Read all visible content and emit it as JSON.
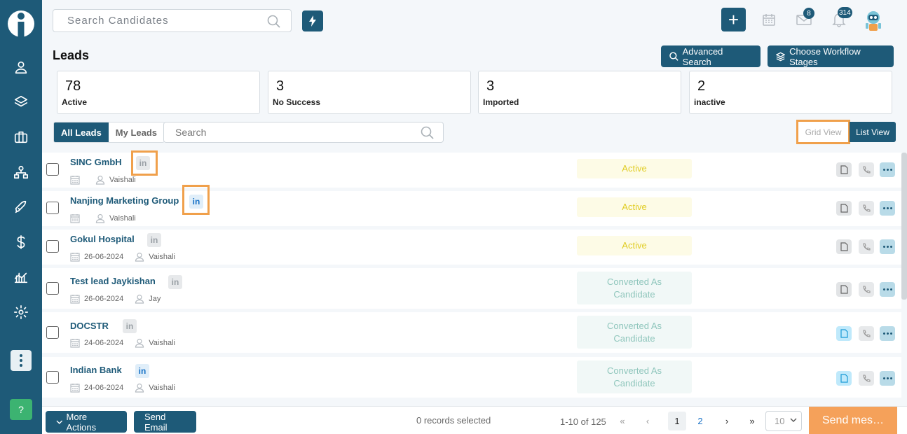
{
  "top": {
    "search_placeholder": "Search Candidates",
    "mail_badge": "8",
    "bell_badge": "314"
  },
  "header": {
    "title": "Leads",
    "advanced_search": "Advanced Search",
    "workflow_stages": "Choose Workflow Stages"
  },
  "stats": [
    {
      "value": "78",
      "label": "Active"
    },
    {
      "value": "3",
      "label": "No Success"
    },
    {
      "value": "3",
      "label": "Imported"
    },
    {
      "value": "2",
      "label": "inactive"
    }
  ],
  "filters": {
    "all_leads": "All Leads",
    "my_leads": "My Leads",
    "search_placeholder": "Search",
    "grid_view": "Grid View",
    "list_view": "List View"
  },
  "leads": [
    {
      "name": "SINC GmbH",
      "date": "",
      "owner": "Vaishali",
      "status": "Active",
      "linkedin": "grey"
    },
    {
      "name": "Nanjing Marketing Group",
      "date": "",
      "owner": "Vaishali",
      "status": "Active",
      "linkedin": "blue"
    },
    {
      "name": "Gokul Hospital",
      "date": "26-06-2024",
      "owner": "Vaishali",
      "status": "Active",
      "linkedin": "grey"
    },
    {
      "name": "Test lead Jaykishan",
      "date": "26-06-2024",
      "owner": "Jay",
      "status": "Converted As Candidate",
      "linkedin": "grey"
    },
    {
      "name": "DOCSTR",
      "date": "24-06-2024",
      "owner": "Vaishali",
      "status": "Converted As Candidate",
      "linkedin": "grey"
    },
    {
      "name": "Indian Bank",
      "date": "24-06-2024",
      "owner": "Vaishali",
      "status": "Converted As Candidate",
      "linkedin": "blue"
    }
  ],
  "linkedin_text": "in",
  "bottom": {
    "more_actions": "More Actions",
    "send_email": "Send Email",
    "records_selected": "0 records selected",
    "range": "1-10 of 125",
    "page_current": "1",
    "page_next": "2",
    "page_size": "10",
    "send_message": "Send mes…"
  },
  "help": "?"
}
